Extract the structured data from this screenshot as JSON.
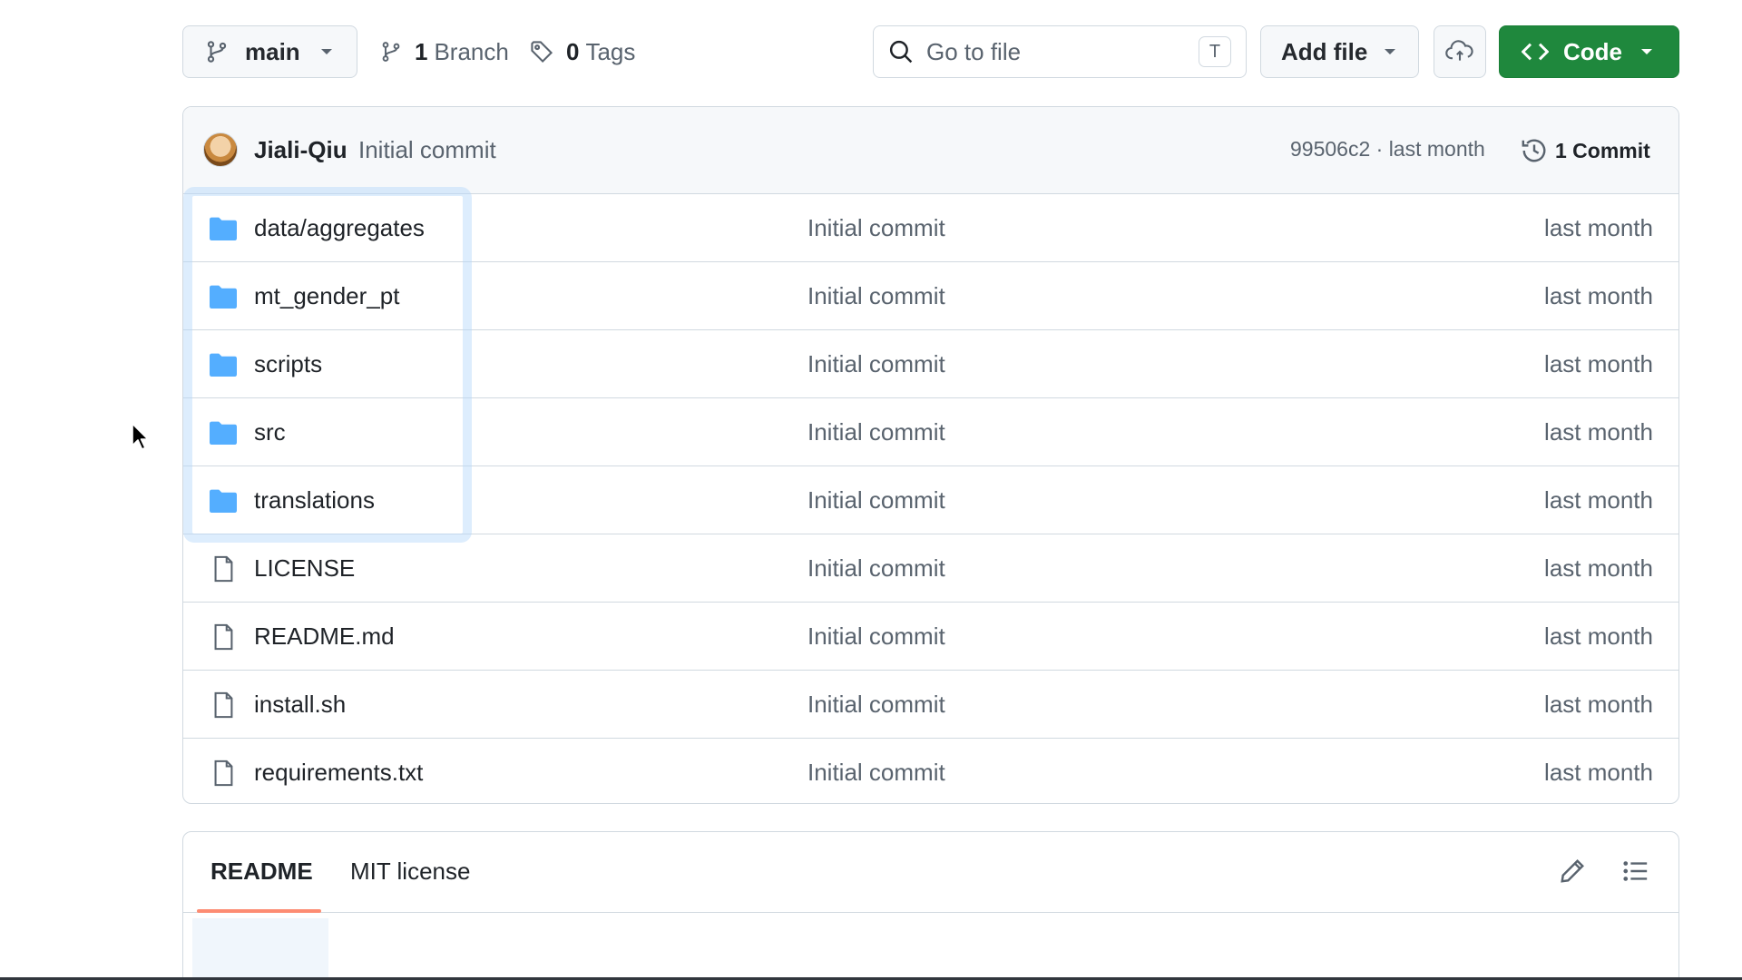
{
  "toolbar": {
    "branch": {
      "name": "main",
      "icon": "git-branch-icon"
    },
    "branches": {
      "count": "1",
      "label": "Branch"
    },
    "tags": {
      "count": "0",
      "label": "Tags"
    },
    "goto_file": {
      "placeholder": "Go to file",
      "shortcut": "T"
    },
    "add_file": {
      "label": "Add file"
    },
    "code": {
      "label": "Code",
      "color": "#1f883d"
    }
  },
  "latest_commit": {
    "author": "Jiali-Qiu",
    "message": "Initial commit",
    "meta": "99506c2 · last month",
    "commits_label": "1 Commit"
  },
  "files": [
    {
      "name": "data/aggregates",
      "type": "folder",
      "message": "Initial commit",
      "age": "last month"
    },
    {
      "name": "mt_gender_pt",
      "type": "folder",
      "message": "Initial commit",
      "age": "last month"
    },
    {
      "name": "scripts",
      "type": "folder",
      "message": "Initial commit",
      "age": "last month"
    },
    {
      "name": "src",
      "type": "folder",
      "message": "Initial commit",
      "age": "last month"
    },
    {
      "name": "translations",
      "type": "folder",
      "message": "Initial commit",
      "age": "last month"
    },
    {
      "name": "LICENSE",
      "type": "file",
      "message": "Initial commit",
      "age": "last month"
    },
    {
      "name": "README.md",
      "type": "file",
      "message": "Initial commit",
      "age": "last month"
    },
    {
      "name": "install.sh",
      "type": "file",
      "message": "Initial commit",
      "age": "last month"
    },
    {
      "name": "requirements.txt",
      "type": "file",
      "message": "Initial commit",
      "age": "last month"
    }
  ],
  "readme": {
    "tabs": [
      "README",
      "MIT license"
    ],
    "active_tab": "README",
    "accent": "#fd8c73"
  },
  "colors": {
    "folder": "#54aeff",
    "border": "#d1d9e0",
    "muted_text": "#59636e"
  }
}
